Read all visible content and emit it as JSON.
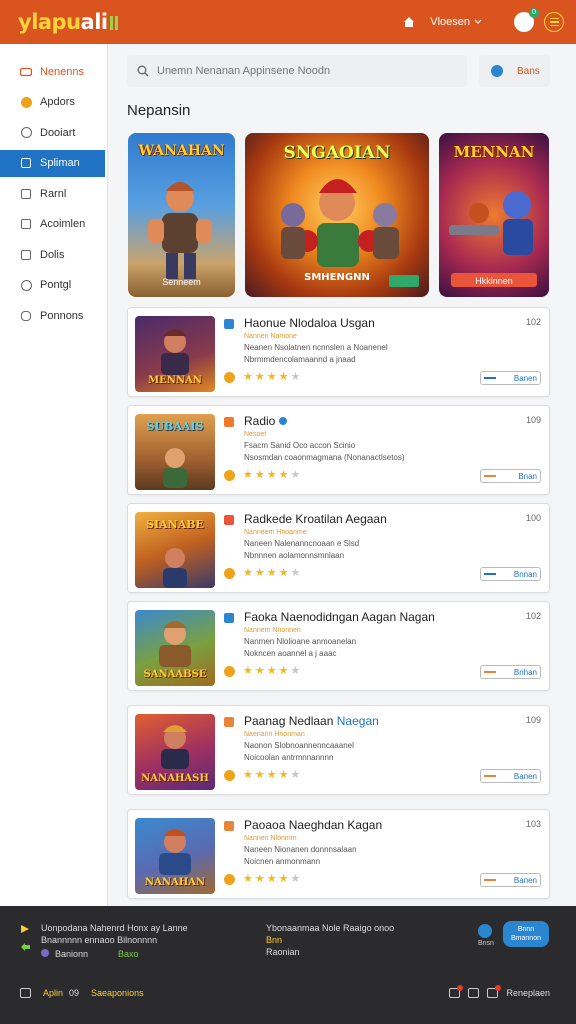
{
  "header": {
    "logo_main": "ylapu",
    "logo_tail": "ali",
    "user_label": "Vloesen",
    "notification_count": "0"
  },
  "sidebar": {
    "items": [
      {
        "label": "Nenenns",
        "icon": "gamepad-icon"
      },
      {
        "label": "Apdors",
        "icon": "coin-icon"
      },
      {
        "label": "Dooiart",
        "icon": "circle-icon"
      },
      {
        "label": "Spliman",
        "icon": "screen-icon"
      },
      {
        "label": "Rarnl",
        "icon": "document-icon"
      },
      {
        "label": "Acoimlen",
        "icon": "monitor-icon"
      },
      {
        "label": "Dolis",
        "icon": "puzzle-icon"
      },
      {
        "label": "Pontgl",
        "icon": "clock-icon"
      },
      {
        "label": "Ponnons",
        "icon": "lock-icon"
      }
    ]
  },
  "search": {
    "placeholder": "Unemn Nenanan Appinsene Noodn",
    "side_label": "Bans"
  },
  "featured": {
    "title": "Nepansin",
    "banners": [
      {
        "title": "WANAHAN",
        "subtitle": "Senneem"
      },
      {
        "title": "SNGAOIAN",
        "subtitle": "SMHENGNN"
      },
      {
        "title": "MENNAN",
        "subtitle": "Hkkinnen"
      }
    ]
  },
  "games": [
    {
      "title": "Haonue Nlodaloa Usgan",
      "title_highlight": "",
      "subtitle": "Nannen Namone",
      "desc1": "Neanen Nsolatnen ncnnslen a Noanenel",
      "desc2": "Nbrmmdencolamaannd a jnaad",
      "count": "102",
      "rating": 4,
      "action": "Banen",
      "thumb_label": "MENNAN"
    },
    {
      "title": "Radio",
      "title_highlight": "",
      "subtitle": "Nesoet",
      "desc1": "Fsacm Sanid Oco accon Scinio",
      "desc2": "Nsosmdan coaonmagmana (Nonanactlsetos)",
      "count": "109",
      "rating": 4,
      "action": "Bnan",
      "thumb_label": "SUBAAIS"
    },
    {
      "title": "Radkede Kroatilan Aegaan",
      "title_highlight": "",
      "subtitle": "Nanneem Hnoanme",
      "desc1": "Naneen Nalenanncnoaan e Slsd",
      "desc2": "Nbnnnen aolamonnsmnlaan",
      "count": "100",
      "rating": 4,
      "action": "Bnnan",
      "thumb_label": "SIANABE"
    },
    {
      "title": "Faoka Naenodidngan Aagan Nagan",
      "title_highlight": "",
      "subtitle": "Nannem Nnonnen",
      "desc1": "Nanmen Nlolioane anmoanelan",
      "desc2": "Nokncen aoannel a j aaac",
      "count": "102",
      "rating": 4,
      "action": "Bnhan",
      "thumb_label": "SANAABSE"
    },
    {
      "title": "Paanag Nedlaan ",
      "title_highlight": "Naegan",
      "subtitle": "Naenann Hnonman",
      "desc1": "Naonon Slobnoannenncaaanel",
      "desc2": "Noicoolan antrmnnannnn",
      "count": "109",
      "rating": 4,
      "action": "Banen",
      "thumb_label": "NANAHASH"
    },
    {
      "title": "Paoaoa Naeghdan Kagan",
      "title_highlight": "",
      "subtitle": "Nannen Nlonmm",
      "desc1": "Naneen Nionanen donnnsalaan",
      "desc2": "Noicnen anmonmann",
      "count": "103",
      "rating": 4,
      "action": "Banen",
      "thumb_label": "NANAHAN"
    }
  ],
  "footer": {
    "line1": "Uonpodana Nahenrd Honx ay Lanne",
    "line2": "Bnannnnn ennaoo Bilnonnnn",
    "line3_prefix": "Banionn",
    "line3_green": "Baxo",
    "right_line1": "Ybonaanmaa Nole Raaigo onoo",
    "right_line2_yellow": "Bnn",
    "right_line3": "Raonian",
    "mini_label": "Bnsn",
    "cta": "Bnnn Bmannon",
    "bottom_left_yellow": "Aplin",
    "bottom_left_num": "09",
    "bottom_left_text": "Saeaponions",
    "bottom_right": "Reneplaen"
  },
  "colors": {
    "header_bg": "#d9541e",
    "accent_blue": "#1f72c4",
    "star": "#f5b71d",
    "footer_bg": "#2b2b2d"
  }
}
